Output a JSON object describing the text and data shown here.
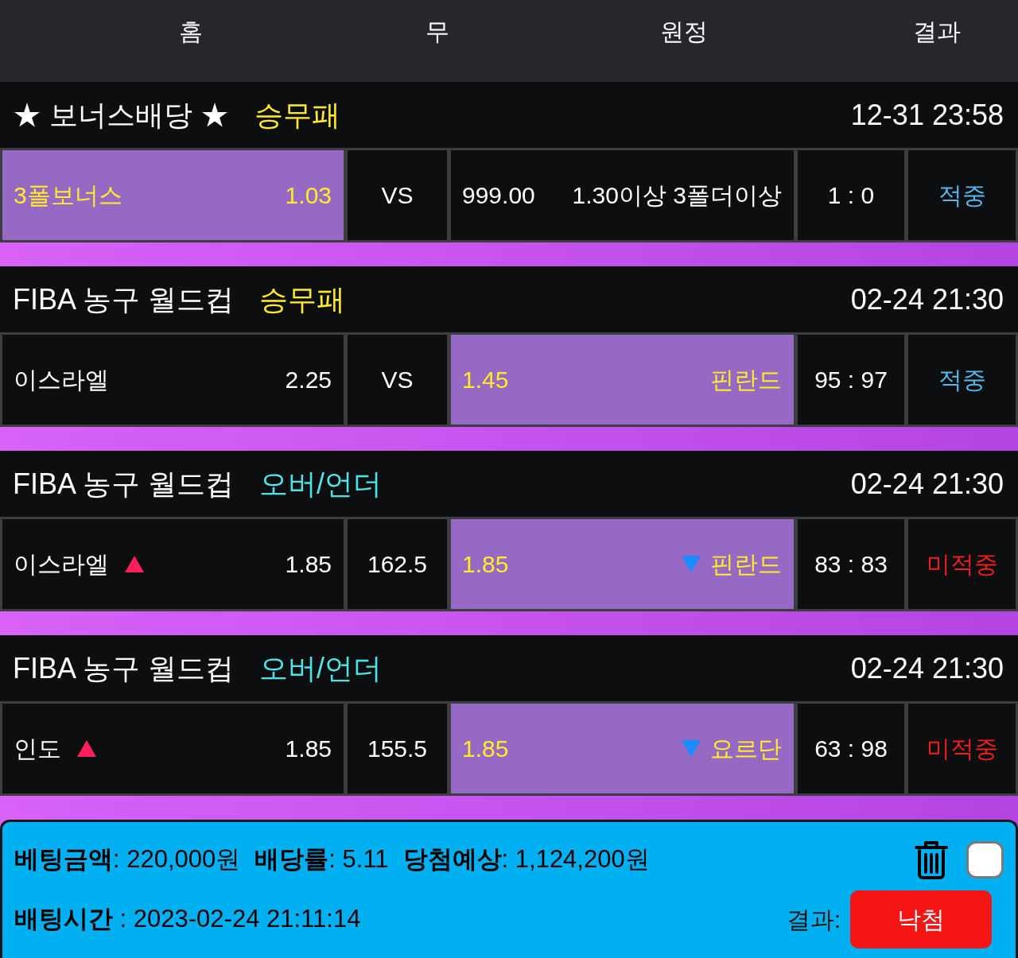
{
  "header": {
    "columns": [
      "홈",
      "무",
      "원정",
      "결과"
    ]
  },
  "matches": [
    {
      "kind": "win_draw_loss",
      "league": "★ 보너스배당 ★",
      "market": {
        "label": "승무패",
        "color": "#ffeb2a"
      },
      "time": "12-31 23:58",
      "home": {
        "name": "3폴보너스",
        "odds": "1.03",
        "selected": true
      },
      "draw": {
        "label": "VS",
        "selected": false
      },
      "away": {
        "odds": "999.00",
        "name": "1.30이상 3폴더이상",
        "selected": false
      },
      "score": "1 : 0",
      "result": {
        "label": "적중",
        "kind": "hit"
      }
    },
    {
      "kind": "win_draw_loss",
      "league": "FIBA 농구 월드컵",
      "market": {
        "label": "승무패",
        "color": "#ffeb2a"
      },
      "time": "02-24 21:30",
      "home": {
        "name": "이스라엘",
        "odds": "2.25",
        "selected": false
      },
      "draw": {
        "label": "VS",
        "selected": false
      },
      "away": {
        "odds": "1.45",
        "name": "핀란드",
        "selected": true
      },
      "score": "95 : 97",
      "result": {
        "label": "적중",
        "kind": "hit"
      }
    },
    {
      "kind": "over_under",
      "league": "FIBA 농구 월드컵",
      "market": {
        "label": "오버/언더",
        "color": "#4fe3e6"
      },
      "time": "02-24 21:30",
      "home": {
        "name": "이스라엘",
        "odds": "1.85",
        "selected": false
      },
      "draw": {
        "label": "162.5",
        "selected": false
      },
      "away": {
        "odds": "1.85",
        "name": "핀란드",
        "selected": true
      },
      "score": "83 : 83",
      "result": {
        "label": "미적중",
        "kind": "miss"
      }
    },
    {
      "kind": "over_under",
      "league": "FIBA 농구 월드컵",
      "market": {
        "label": "오버/언더",
        "color": "#4fe3e6"
      },
      "time": "02-24 21:30",
      "home": {
        "name": "인도",
        "odds": "1.85",
        "selected": false
      },
      "draw": {
        "label": "155.5",
        "selected": false
      },
      "away": {
        "odds": "1.85",
        "name": "요르단",
        "selected": true
      },
      "score": "63 : 98",
      "result": {
        "label": "미적중",
        "kind": "miss"
      }
    }
  ],
  "summary": {
    "stats": [
      "**베팅금액**: 220,000원",
      "**배당률**: 5.11",
      "**당첨예상**: 1,124,200원"
    ],
    "checked": false,
    "bet_time": "**배팅시간** : 2023-02-24 21:11:14",
    "result_label": "결과:",
    "result_button": {
      "label": "낙첨"
    }
  }
}
